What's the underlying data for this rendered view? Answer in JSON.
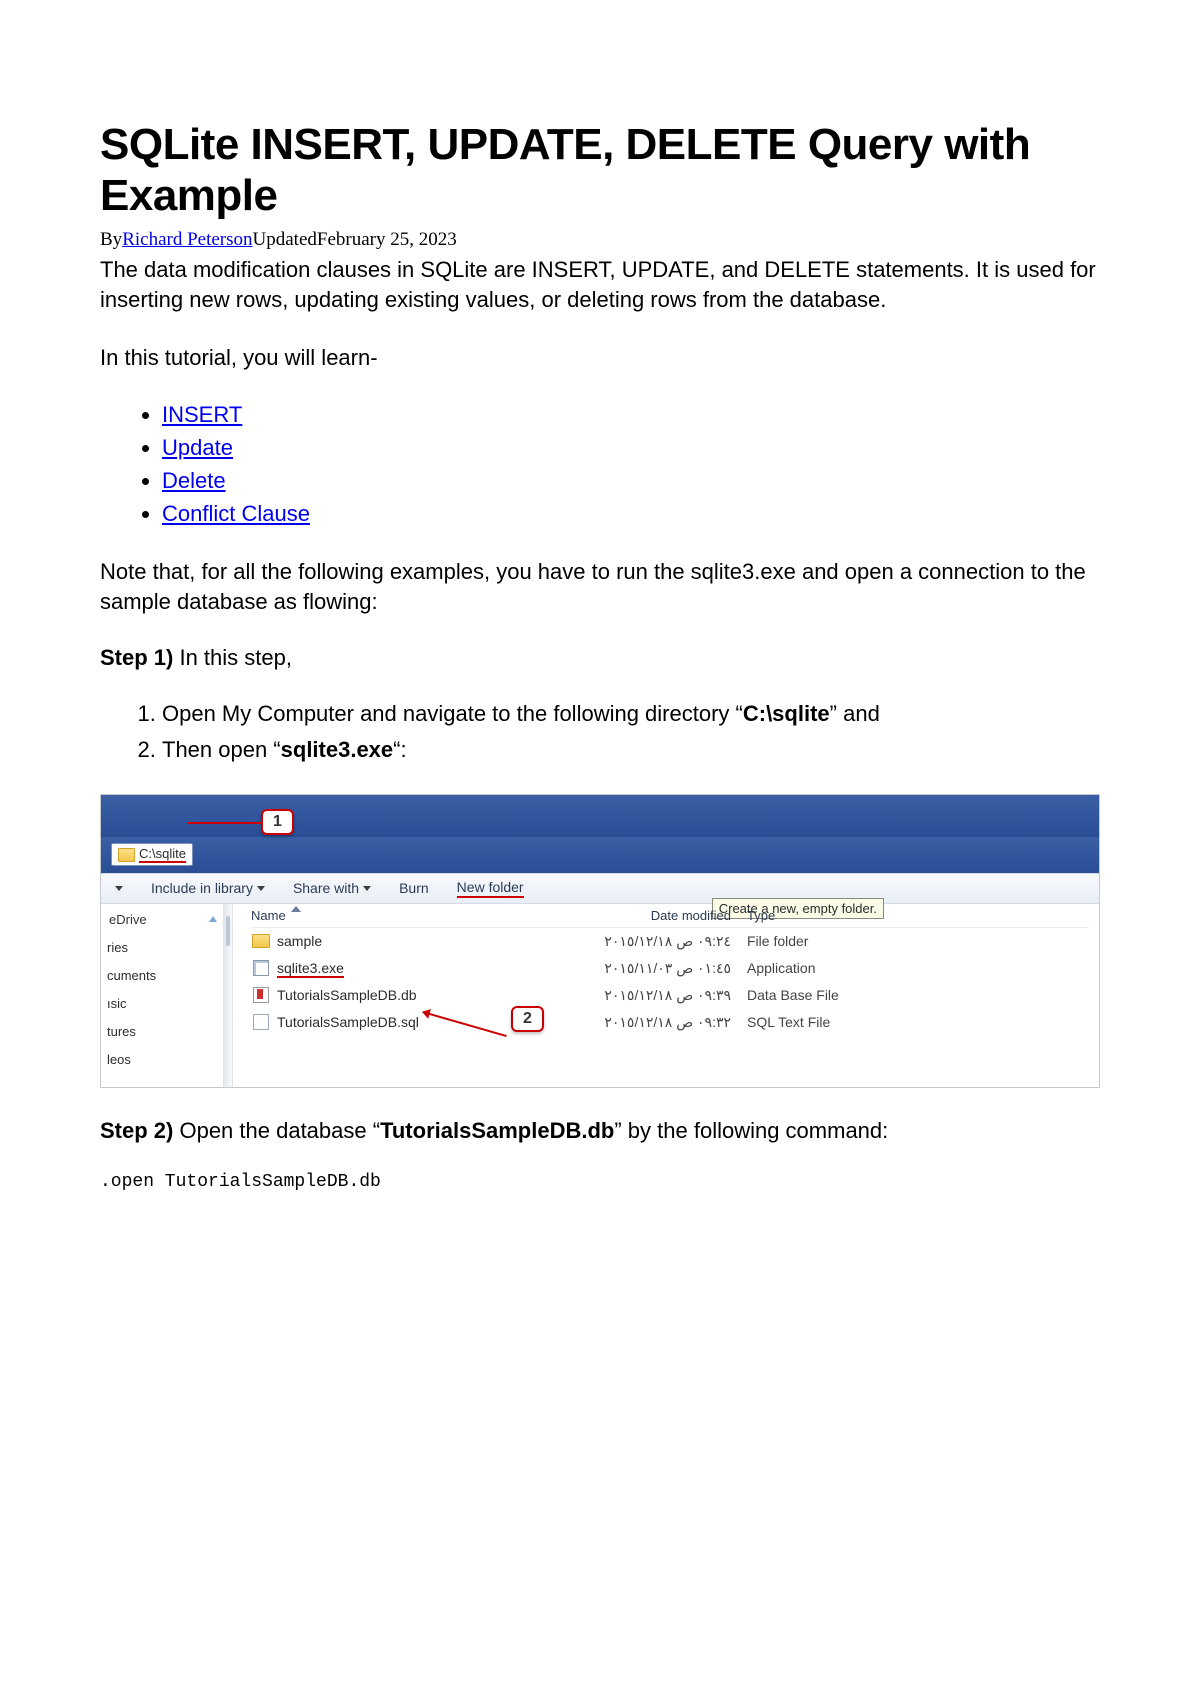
{
  "title": "SQLite INSERT, UPDATE, DELETE Query with Example",
  "byline": {
    "by": "By",
    "author": "Richard Peterson",
    "updated_label": "Updated",
    "updated_date": "February 25, 2023"
  },
  "intro": "The data modification clauses in SQLite are INSERT, UPDATE, and DELETE statements. It is used for inserting new rows, updating existing values, or deleting rows from the database.",
  "learn_intro": "In this tutorial, you will learn-",
  "toc": [
    "INSERT",
    "Update",
    "Delete",
    "Conflict Clause"
  ],
  "note": "Note that, for all the following examples, you have to run the sqlite3.exe and open a connection to the sample database as flowing:",
  "step1": {
    "label": "Step 1)",
    "text": " In this step,",
    "items": [
      {
        "pre": "Open My Computer and navigate to the following directory “",
        "bold": "C:\\sqlite",
        "post": "” and"
      },
      {
        "pre": "Then open “",
        "bold": "sqlite3.exe",
        "post": "“:"
      }
    ]
  },
  "explorer": {
    "path": "C:\\sqlite",
    "callout1": "1",
    "callout2": "2",
    "toolbar": {
      "include": "Include in library",
      "share": "Share with",
      "burn": "Burn",
      "newfolder": "New folder",
      "tooltip": "Create a new, empty folder."
    },
    "sidebar_top": "eDrive",
    "sidebar": [
      "ries",
      "cuments",
      "ısic",
      "tures",
      "leos"
    ],
    "columns": {
      "name": "Name",
      "date": "Date modified",
      "type": "Type"
    },
    "files": [
      {
        "icon": "folder",
        "name": "sample",
        "date": "٠٩:٢٤ ص ٢٠١٥/١٢/١٨",
        "type": "File folder"
      },
      {
        "icon": "exe",
        "name": "sqlite3.exe",
        "date": "٠١:٤٥ ص ٢٠١٥/١١/٠٣",
        "type": "Application",
        "underline": true
      },
      {
        "icon": "db",
        "name": "TutorialsSampleDB.db",
        "date": "٠٩:٣٩ ص ٢٠١٥/١٢/١٨",
        "type": "Data Base File"
      },
      {
        "icon": "sql",
        "name": "TutorialsSampleDB.sql",
        "date": "٠٩:٣٢ ص ٢٠١٥/١٢/١٨",
        "type": "SQL Text File"
      }
    ]
  },
  "step2": {
    "label": "Step 2)",
    "pre": " Open the database “",
    "bold": "TutorialsSampleDB.db",
    "post": "” by the following command:"
  },
  "code": ".open TutorialsSampleDB.db"
}
